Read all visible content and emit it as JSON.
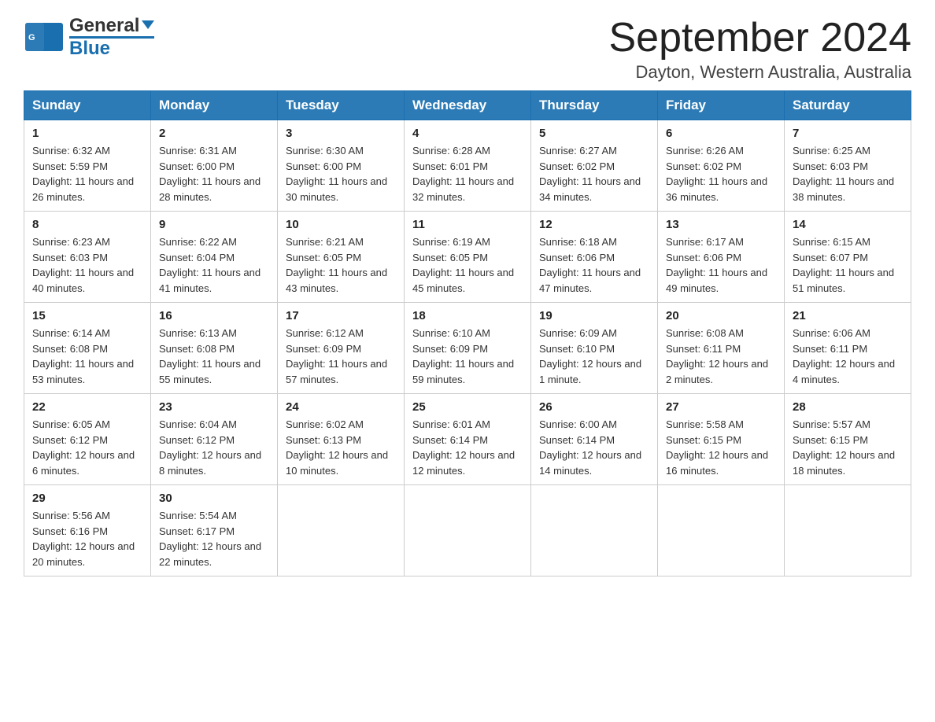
{
  "logo": {
    "text_general": "General",
    "text_blue": "Blue"
  },
  "header": {
    "title": "September 2024",
    "subtitle": "Dayton, Western Australia, Australia"
  },
  "weekdays": [
    "Sunday",
    "Monday",
    "Tuesday",
    "Wednesday",
    "Thursday",
    "Friday",
    "Saturday"
  ],
  "weeks": [
    [
      {
        "day": "1",
        "sunrise": "Sunrise: 6:32 AM",
        "sunset": "Sunset: 5:59 PM",
        "daylight": "Daylight: 11 hours and 26 minutes."
      },
      {
        "day": "2",
        "sunrise": "Sunrise: 6:31 AM",
        "sunset": "Sunset: 6:00 PM",
        "daylight": "Daylight: 11 hours and 28 minutes."
      },
      {
        "day": "3",
        "sunrise": "Sunrise: 6:30 AM",
        "sunset": "Sunset: 6:00 PM",
        "daylight": "Daylight: 11 hours and 30 minutes."
      },
      {
        "day": "4",
        "sunrise": "Sunrise: 6:28 AM",
        "sunset": "Sunset: 6:01 PM",
        "daylight": "Daylight: 11 hours and 32 minutes."
      },
      {
        "day": "5",
        "sunrise": "Sunrise: 6:27 AM",
        "sunset": "Sunset: 6:02 PM",
        "daylight": "Daylight: 11 hours and 34 minutes."
      },
      {
        "day": "6",
        "sunrise": "Sunrise: 6:26 AM",
        "sunset": "Sunset: 6:02 PM",
        "daylight": "Daylight: 11 hours and 36 minutes."
      },
      {
        "day": "7",
        "sunrise": "Sunrise: 6:25 AM",
        "sunset": "Sunset: 6:03 PM",
        "daylight": "Daylight: 11 hours and 38 minutes."
      }
    ],
    [
      {
        "day": "8",
        "sunrise": "Sunrise: 6:23 AM",
        "sunset": "Sunset: 6:03 PM",
        "daylight": "Daylight: 11 hours and 40 minutes."
      },
      {
        "day": "9",
        "sunrise": "Sunrise: 6:22 AM",
        "sunset": "Sunset: 6:04 PM",
        "daylight": "Daylight: 11 hours and 41 minutes."
      },
      {
        "day": "10",
        "sunrise": "Sunrise: 6:21 AM",
        "sunset": "Sunset: 6:05 PM",
        "daylight": "Daylight: 11 hours and 43 minutes."
      },
      {
        "day": "11",
        "sunrise": "Sunrise: 6:19 AM",
        "sunset": "Sunset: 6:05 PM",
        "daylight": "Daylight: 11 hours and 45 minutes."
      },
      {
        "day": "12",
        "sunrise": "Sunrise: 6:18 AM",
        "sunset": "Sunset: 6:06 PM",
        "daylight": "Daylight: 11 hours and 47 minutes."
      },
      {
        "day": "13",
        "sunrise": "Sunrise: 6:17 AM",
        "sunset": "Sunset: 6:06 PM",
        "daylight": "Daylight: 11 hours and 49 minutes."
      },
      {
        "day": "14",
        "sunrise": "Sunrise: 6:15 AM",
        "sunset": "Sunset: 6:07 PM",
        "daylight": "Daylight: 11 hours and 51 minutes."
      }
    ],
    [
      {
        "day": "15",
        "sunrise": "Sunrise: 6:14 AM",
        "sunset": "Sunset: 6:08 PM",
        "daylight": "Daylight: 11 hours and 53 minutes."
      },
      {
        "day": "16",
        "sunrise": "Sunrise: 6:13 AM",
        "sunset": "Sunset: 6:08 PM",
        "daylight": "Daylight: 11 hours and 55 minutes."
      },
      {
        "day": "17",
        "sunrise": "Sunrise: 6:12 AM",
        "sunset": "Sunset: 6:09 PM",
        "daylight": "Daylight: 11 hours and 57 minutes."
      },
      {
        "day": "18",
        "sunrise": "Sunrise: 6:10 AM",
        "sunset": "Sunset: 6:09 PM",
        "daylight": "Daylight: 11 hours and 59 minutes."
      },
      {
        "day": "19",
        "sunrise": "Sunrise: 6:09 AM",
        "sunset": "Sunset: 6:10 PM",
        "daylight": "Daylight: 12 hours and 1 minute."
      },
      {
        "day": "20",
        "sunrise": "Sunrise: 6:08 AM",
        "sunset": "Sunset: 6:11 PM",
        "daylight": "Daylight: 12 hours and 2 minutes."
      },
      {
        "day": "21",
        "sunrise": "Sunrise: 6:06 AM",
        "sunset": "Sunset: 6:11 PM",
        "daylight": "Daylight: 12 hours and 4 minutes."
      }
    ],
    [
      {
        "day": "22",
        "sunrise": "Sunrise: 6:05 AM",
        "sunset": "Sunset: 6:12 PM",
        "daylight": "Daylight: 12 hours and 6 minutes."
      },
      {
        "day": "23",
        "sunrise": "Sunrise: 6:04 AM",
        "sunset": "Sunset: 6:12 PM",
        "daylight": "Daylight: 12 hours and 8 minutes."
      },
      {
        "day": "24",
        "sunrise": "Sunrise: 6:02 AM",
        "sunset": "Sunset: 6:13 PM",
        "daylight": "Daylight: 12 hours and 10 minutes."
      },
      {
        "day": "25",
        "sunrise": "Sunrise: 6:01 AM",
        "sunset": "Sunset: 6:14 PM",
        "daylight": "Daylight: 12 hours and 12 minutes."
      },
      {
        "day": "26",
        "sunrise": "Sunrise: 6:00 AM",
        "sunset": "Sunset: 6:14 PM",
        "daylight": "Daylight: 12 hours and 14 minutes."
      },
      {
        "day": "27",
        "sunrise": "Sunrise: 5:58 AM",
        "sunset": "Sunset: 6:15 PM",
        "daylight": "Daylight: 12 hours and 16 minutes."
      },
      {
        "day": "28",
        "sunrise": "Sunrise: 5:57 AM",
        "sunset": "Sunset: 6:15 PM",
        "daylight": "Daylight: 12 hours and 18 minutes."
      }
    ],
    [
      {
        "day": "29",
        "sunrise": "Sunrise: 5:56 AM",
        "sunset": "Sunset: 6:16 PM",
        "daylight": "Daylight: 12 hours and 20 minutes."
      },
      {
        "day": "30",
        "sunrise": "Sunrise: 5:54 AM",
        "sunset": "Sunset: 6:17 PM",
        "daylight": "Daylight: 12 hours and 22 minutes."
      },
      null,
      null,
      null,
      null,
      null
    ]
  ]
}
